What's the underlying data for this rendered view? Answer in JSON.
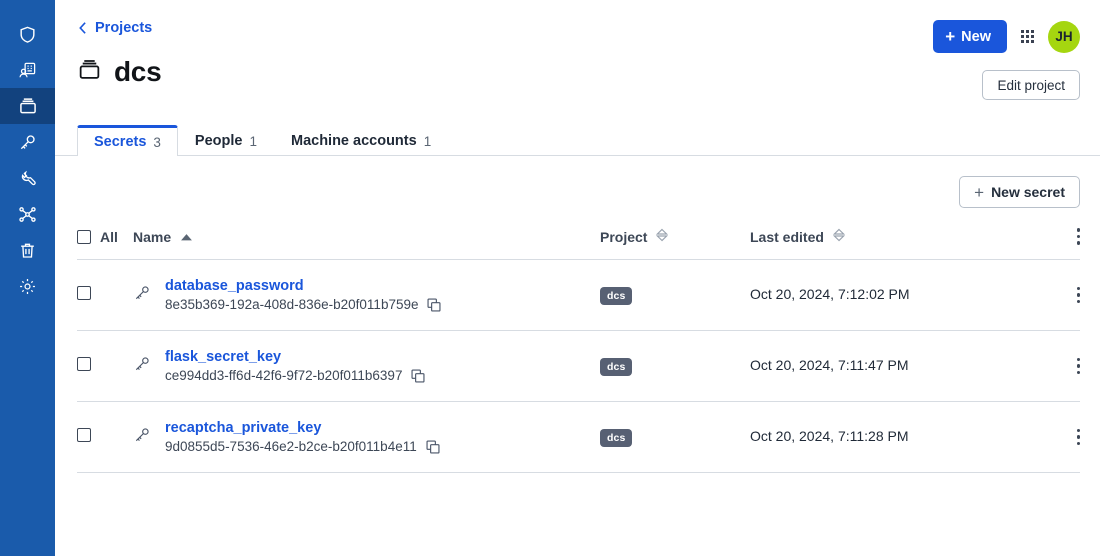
{
  "sidebar": {
    "items": [
      {
        "icon": "shield-icon",
        "name": "sidebar-item-shield",
        "active": false
      },
      {
        "icon": "machine-accounts-icon",
        "name": "sidebar-item-machine-accounts",
        "active": false
      },
      {
        "icon": "projects-box-icon",
        "name": "sidebar-item-projects",
        "active": true
      },
      {
        "icon": "key-icon",
        "name": "sidebar-item-secrets",
        "active": false
      },
      {
        "icon": "wrench-icon",
        "name": "sidebar-item-tools",
        "active": false
      },
      {
        "icon": "network-icon",
        "name": "sidebar-item-integrations",
        "active": false
      },
      {
        "icon": "trash-icon",
        "name": "sidebar-item-trash",
        "active": false
      },
      {
        "icon": "gear-icon",
        "name": "sidebar-item-settings",
        "active": false
      }
    ],
    "bg_color": "#1a5bab",
    "active_bg_color": "#12427e"
  },
  "header": {
    "breadcrumb_label": "Projects",
    "breadcrumb_icon": "chevron-left-icon",
    "project_icon": "projects-box-icon",
    "project_title": "dcs",
    "new_button_label": "New",
    "new_button_plus": "+",
    "new_button_color": "#1a56db",
    "apps_grid_icon": "apps-grid-icon",
    "avatar_initials": "JH",
    "avatar_color": "#a5d610",
    "edit_project_label": "Edit project"
  },
  "tabs": [
    {
      "label": "Secrets",
      "count": "3",
      "active": true,
      "name": "tab-secrets"
    },
    {
      "label": "People",
      "count": "1",
      "active": false,
      "name": "tab-people"
    },
    {
      "label": "Machine accounts",
      "count": "1",
      "active": false,
      "name": "tab-machine-accounts"
    }
  ],
  "toolbar": {
    "new_secret_label": "New secret",
    "new_secret_plus": "+"
  },
  "table": {
    "columns": {
      "all_label": "All",
      "name": "Name",
      "name_sort": "sort-ascending-icon",
      "project": "Project",
      "project_sort": "sort-none-icon",
      "last_edited": "Last edited",
      "last_edited_sort": "sort-none-icon",
      "menu_icon": "kebab-menu-icon"
    },
    "rows": [
      {
        "icon": "key-icon",
        "name": "database_password",
        "uuid": "8e35b369-192a-408d-836e-b20f011b759e",
        "copy_icon": "copy-icon",
        "project": "dcs",
        "last_edited": "Oct 20, 2024, 7:12:02 PM",
        "menu_icon": "kebab-menu-icon"
      },
      {
        "icon": "key-icon",
        "name": "flask_secret_key",
        "uuid": "ce994dd3-ff6d-42f6-9f72-b20f011b6397",
        "copy_icon": "copy-icon",
        "project": "dcs",
        "last_edited": "Oct 20, 2024, 7:11:47 PM",
        "menu_icon": "kebab-menu-icon"
      },
      {
        "icon": "key-icon",
        "name": "recaptcha_private_key",
        "uuid": "9d0855d5-7536-46e2-b2ce-b20f011b4e11",
        "copy_icon": "copy-icon",
        "project": "dcs",
        "last_edited": "Oct 20, 2024, 7:11:28 PM",
        "menu_icon": "kebab-menu-icon"
      }
    ]
  },
  "colors": {
    "link": "#1a56db",
    "badge_bg": "#576073",
    "border": "#d7dce2"
  }
}
